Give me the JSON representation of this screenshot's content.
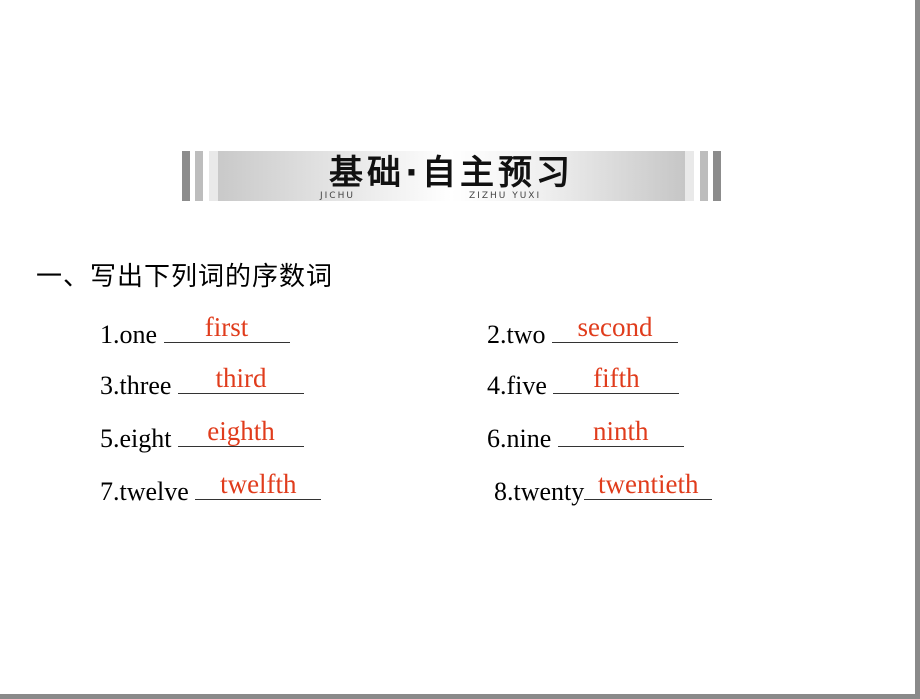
{
  "banner": {
    "title": "基础·自主预习",
    "subtitle_left": "JICHU",
    "subtitle_right": "ZIZHU YUXI"
  },
  "section": {
    "heading": "一、写出下列词的序数词"
  },
  "colors": {
    "answer": "#e03c1c",
    "frame": "#8a8a8a"
  },
  "exercises": [
    {
      "prompt": "1.one",
      "answer": "first"
    },
    {
      "prompt": "2.two",
      "answer": "second"
    },
    {
      "prompt": "3.three",
      "answer": "third"
    },
    {
      "prompt": "4.five",
      "answer": "fifth"
    },
    {
      "prompt": "5.eight",
      "answer": "eighth"
    },
    {
      "prompt": "6.nine",
      "answer": "ninth"
    },
    {
      "prompt": "7.twelve",
      "answer": "twelfth"
    },
    {
      "prompt": "8.twenty",
      "answer": "twentieth"
    }
  ]
}
